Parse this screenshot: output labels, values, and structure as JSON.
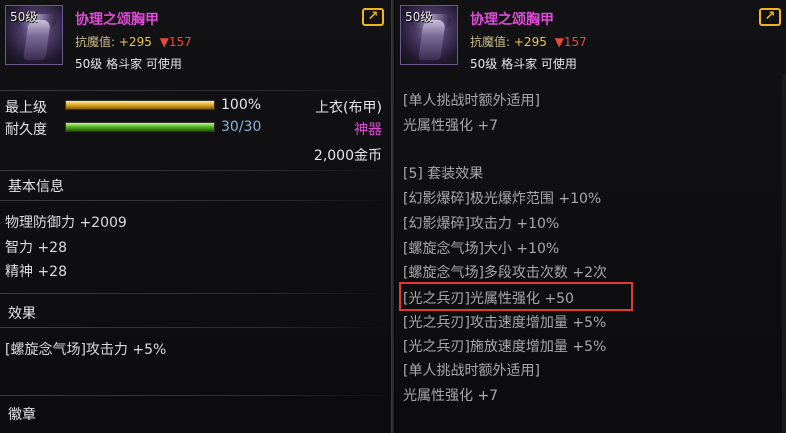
{
  "item": {
    "level_tag": "50级",
    "name": "协理之颂胸甲",
    "magic_resist_label": "抗魔值:",
    "magic_resist_value": "+295",
    "magic_resist_diff": "▼157",
    "requirement": "50级 格斗家 可使用",
    "corner_icon": "share-arrow-icon"
  },
  "left": {
    "upgrade_label": "最上级",
    "upgrade_value": "100%",
    "upgrade_fill_percent": 100,
    "durability_label": "耐久度",
    "durability_value": "30/30",
    "durability_fill_percent": 100,
    "slot_type": "上衣(布甲)",
    "rarity": "神器",
    "price": "2,000金币",
    "basic_info_title": "基本信息",
    "phys_def": "物理防御力 +2009",
    "intelligence": "智力 +28",
    "spirit": "精神 +28",
    "effect_title": "效果",
    "effect_line": "[螺旋念气场]攻击力 +5%",
    "emblem_title": "徽章"
  },
  "right": {
    "lines": [
      "[单人挑战时额外适用]",
      "光属性强化 +7",
      "[5] 套装效果",
      "[幻影爆碎]极光爆炸范围 +10%",
      "[幻影爆碎]攻击力 +10%",
      "[螺旋念气场]大小 +10%",
      "[螺旋念气场]多段攻击次数 +2次",
      "[光之兵刃]光属性强化 +50",
      "[光之兵刃]攻击速度增加量 +5%",
      "[光之兵刃]施放速度增加量 +5%",
      "[单人挑战时额外适用]",
      "光属性强化 +7"
    ]
  },
  "colors": {
    "name": "#e04bd8",
    "gold": "#e9c64d",
    "down": "#e84a3a",
    "rarity": "#e04bd8",
    "highlight": "#e2392f"
  }
}
